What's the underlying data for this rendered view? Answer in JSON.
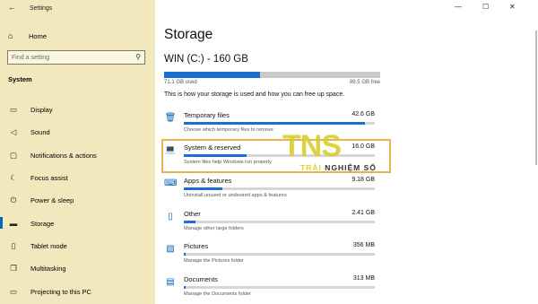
{
  "window": {
    "title": "Settings",
    "back_icon": "back-arrow-icon",
    "minimize_glyph": "—",
    "maximize_glyph": "☐",
    "close_glyph": "✕"
  },
  "sidebar": {
    "home_label": "Home",
    "search_placeholder": "Find a setting",
    "section_label": "System",
    "items": [
      {
        "label": "Display",
        "icon": "display-icon",
        "glyph": "▭"
      },
      {
        "label": "Sound",
        "icon": "sound-icon",
        "glyph": "◁"
      },
      {
        "label": "Notifications & actions",
        "icon": "notifications-icon",
        "glyph": "▢"
      },
      {
        "label": "Focus assist",
        "icon": "focus-assist-icon",
        "glyph": "☾"
      },
      {
        "label": "Power & sleep",
        "icon": "power-icon",
        "glyph": "⏻"
      },
      {
        "label": "Storage",
        "icon": "storage-icon",
        "glyph": "▬",
        "active": true
      },
      {
        "label": "Tablet mode",
        "icon": "tablet-icon",
        "glyph": "▯"
      },
      {
        "label": "Multitasking",
        "icon": "multitasking-icon",
        "glyph": "❐"
      },
      {
        "label": "Projecting to this PC",
        "icon": "projecting-icon",
        "glyph": "▭"
      }
    ]
  },
  "main": {
    "title": "Storage",
    "drive": {
      "name": "WIN (C:) - 160 GB",
      "used": "71.1 GB used",
      "free": "89.5 GB free",
      "used_fraction": 0.444
    },
    "description": "This is how your storage is used and how you can free up space.",
    "categories": [
      {
        "name": "Temporary files",
        "size": "42.6 GB",
        "sub": "Choose which temporary files to remove",
        "icon": "trash-icon",
        "glyph": "🗑",
        "fraction": 0.95
      },
      {
        "name": "System & reserved",
        "size": "16.0 GB",
        "sub": "System files help Windows run properly",
        "icon": "laptop-icon",
        "glyph": "💻",
        "fraction": 0.33
      },
      {
        "name": "Apps & features",
        "size": "9.18 GB",
        "sub": "Uninstall unused or undesired apps & features",
        "icon": "apps-icon",
        "glyph": "⌨",
        "fraction": 0.2
      },
      {
        "name": "Other",
        "size": "2.41 GB",
        "sub": "Manage other large folders",
        "icon": "folder-icon",
        "glyph": "▯",
        "fraction": 0.06
      },
      {
        "name": "Pictures",
        "size": "356 MB",
        "sub": "Manage the Pictures folder",
        "icon": "pictures-icon",
        "glyph": "▧",
        "fraction": 0.01
      },
      {
        "name": "Documents",
        "size": "313 MB",
        "sub": "Manage the Documents folder",
        "icon": "documents-icon",
        "glyph": "▤",
        "fraction": 0.01
      }
    ]
  },
  "watermark": {
    "big": "TNS",
    "small_left": "TRẢI ",
    "small_right": "NGHIỆM SỐ"
  },
  "colors": {
    "accent": "#1c6fce",
    "sidebar_bg": "#f1e9bd",
    "highlight": "#e8b34d"
  }
}
